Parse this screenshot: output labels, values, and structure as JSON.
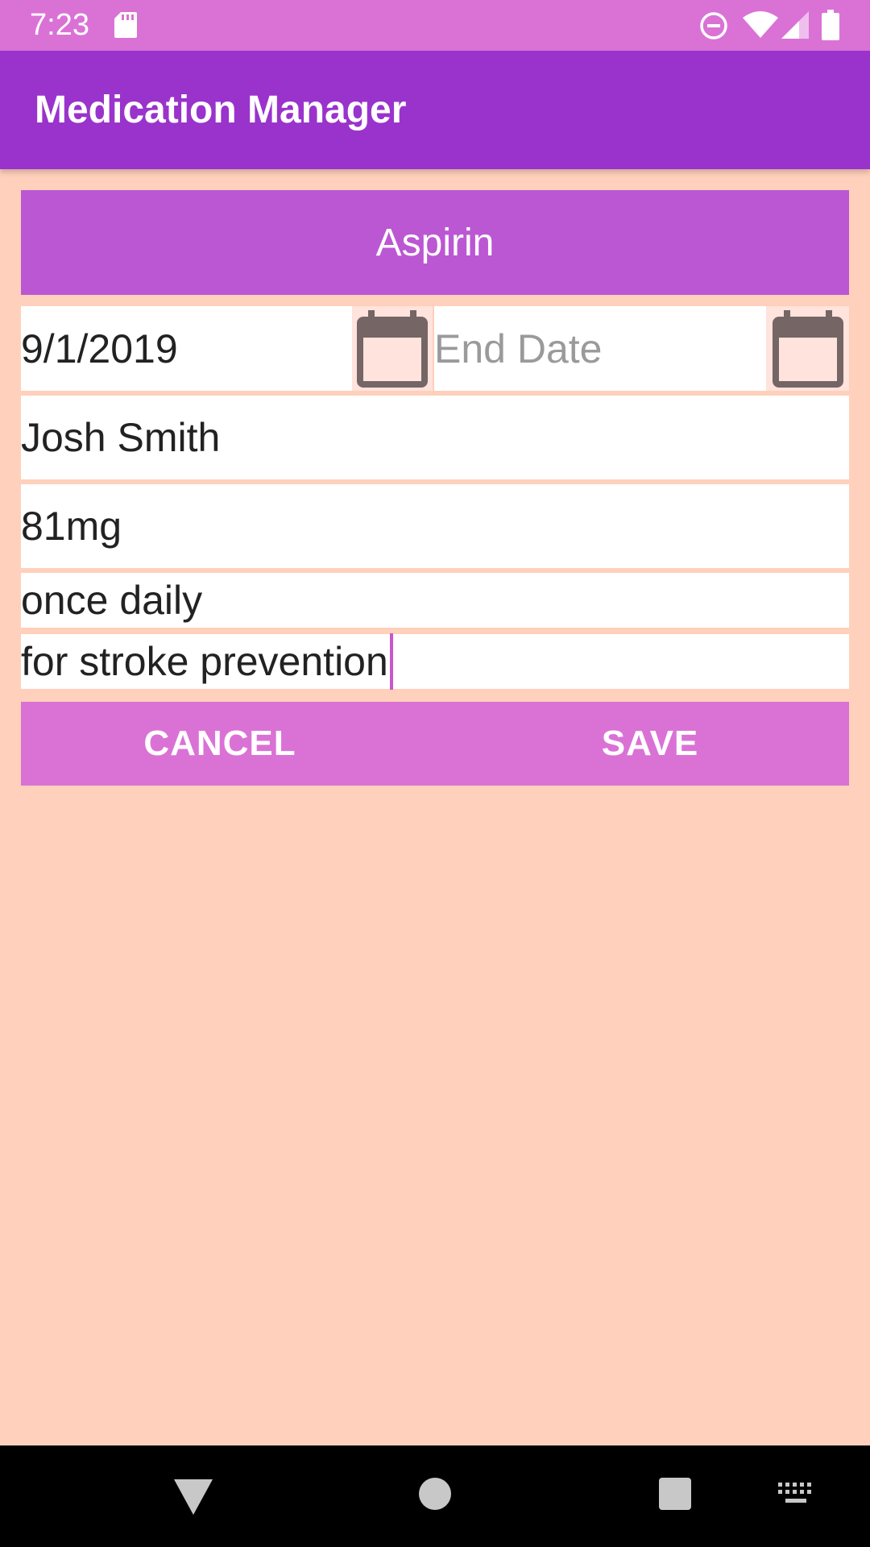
{
  "status_bar": {
    "time": "7:23",
    "icons": [
      "sd-card-icon",
      "do-not-disturb-icon",
      "wifi-icon",
      "signal-icon",
      "battery-icon"
    ]
  },
  "app_bar": {
    "title": "Medication Manager"
  },
  "medication": {
    "name": "Aspirin",
    "start_date": "9/1/2019",
    "end_date_placeholder": "End Date",
    "prescriber": "Josh Smith",
    "dose": "81mg",
    "frequency": "once daily",
    "notes": "for stroke prevention"
  },
  "actions": {
    "cancel_label": "CANCEL",
    "save_label": "SAVE"
  },
  "colors": {
    "status_bar": "#da72d6",
    "app_bar": "#9a33cc",
    "name_bar": "#bb57d3",
    "buttons": "#da72d6",
    "background": "#ffd0bb"
  },
  "nav_bar": {
    "icons": [
      "back-icon",
      "home-icon",
      "recents-icon",
      "keyboard-icon"
    ]
  }
}
